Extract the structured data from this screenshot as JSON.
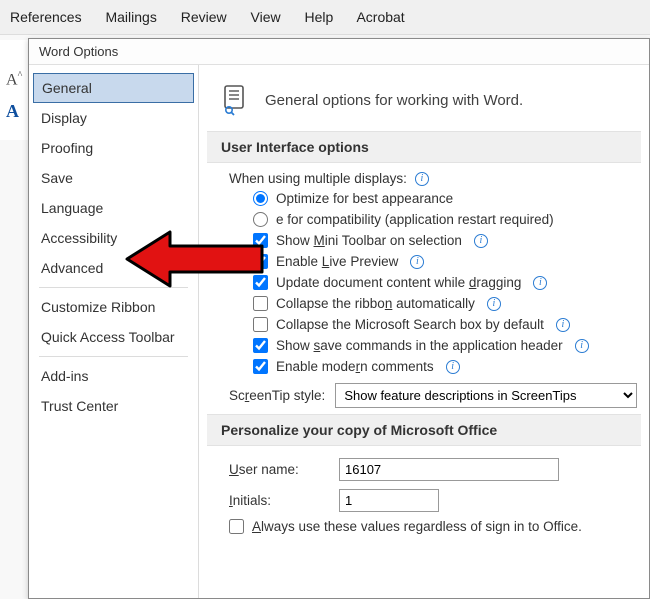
{
  "ribbon": [
    "References",
    "Mailings",
    "Review",
    "View",
    "Help",
    "Acrobat"
  ],
  "dialog": {
    "title": "Word Options"
  },
  "sidebar": {
    "items": [
      "General",
      "Display",
      "Proofing",
      "Save",
      "Language",
      "Accessibility",
      "Advanced",
      "Customize Ribbon",
      "Quick Access Toolbar",
      "Add-ins",
      "Trust Center"
    ],
    "selected_index": 0
  },
  "main": {
    "heading": "General options for working with Word.",
    "ui_section": "User Interface options",
    "displays_label": "When using multiple displays:",
    "radio_optimize": "Optimize for best appearance",
    "radio_compat_suffix": "e for compatibility (application restart required)",
    "chk_mini_prefix": "Show ",
    "chk_mini_acc": "M",
    "chk_mini_rest": "ini Toolbar on selection",
    "chk_live_prefix": "Enable ",
    "chk_live_acc": "L",
    "chk_live_rest": "ive Preview",
    "chk_drag_prefix": "Update document content while ",
    "chk_drag_acc": "d",
    "chk_drag_rest": "ragging",
    "chk_ribbon_prefix": "Collapse the ribbo",
    "chk_ribbon_acc": "n",
    "chk_ribbon_rest": " automatically",
    "chk_search": "Collapse the Microsoft Search box by default",
    "chk_save_prefix": "Show ",
    "chk_save_acc": "s",
    "chk_save_rest": "ave commands in the application header",
    "chk_modern_prefix": "Enable mode",
    "chk_modern_acc": "r",
    "chk_modern_rest": "n comments",
    "screentip_label_prefix": "Sc",
    "screentip_label_acc": "r",
    "screentip_label_rest": "eenTip style:",
    "screentip_value": "Show feature descriptions in ScreenTips",
    "personalize_section": "Personalize your copy of Microsoft Office",
    "user_label_acc": "U",
    "user_label_rest": "ser name:",
    "user_value": "16107",
    "initials_label_acc": "I",
    "initials_label_rest": "nitials:",
    "initials_value": "1",
    "always_prefix": "",
    "always_acc": "A",
    "always_rest": "lways use these values regardless of sign in to Office."
  }
}
